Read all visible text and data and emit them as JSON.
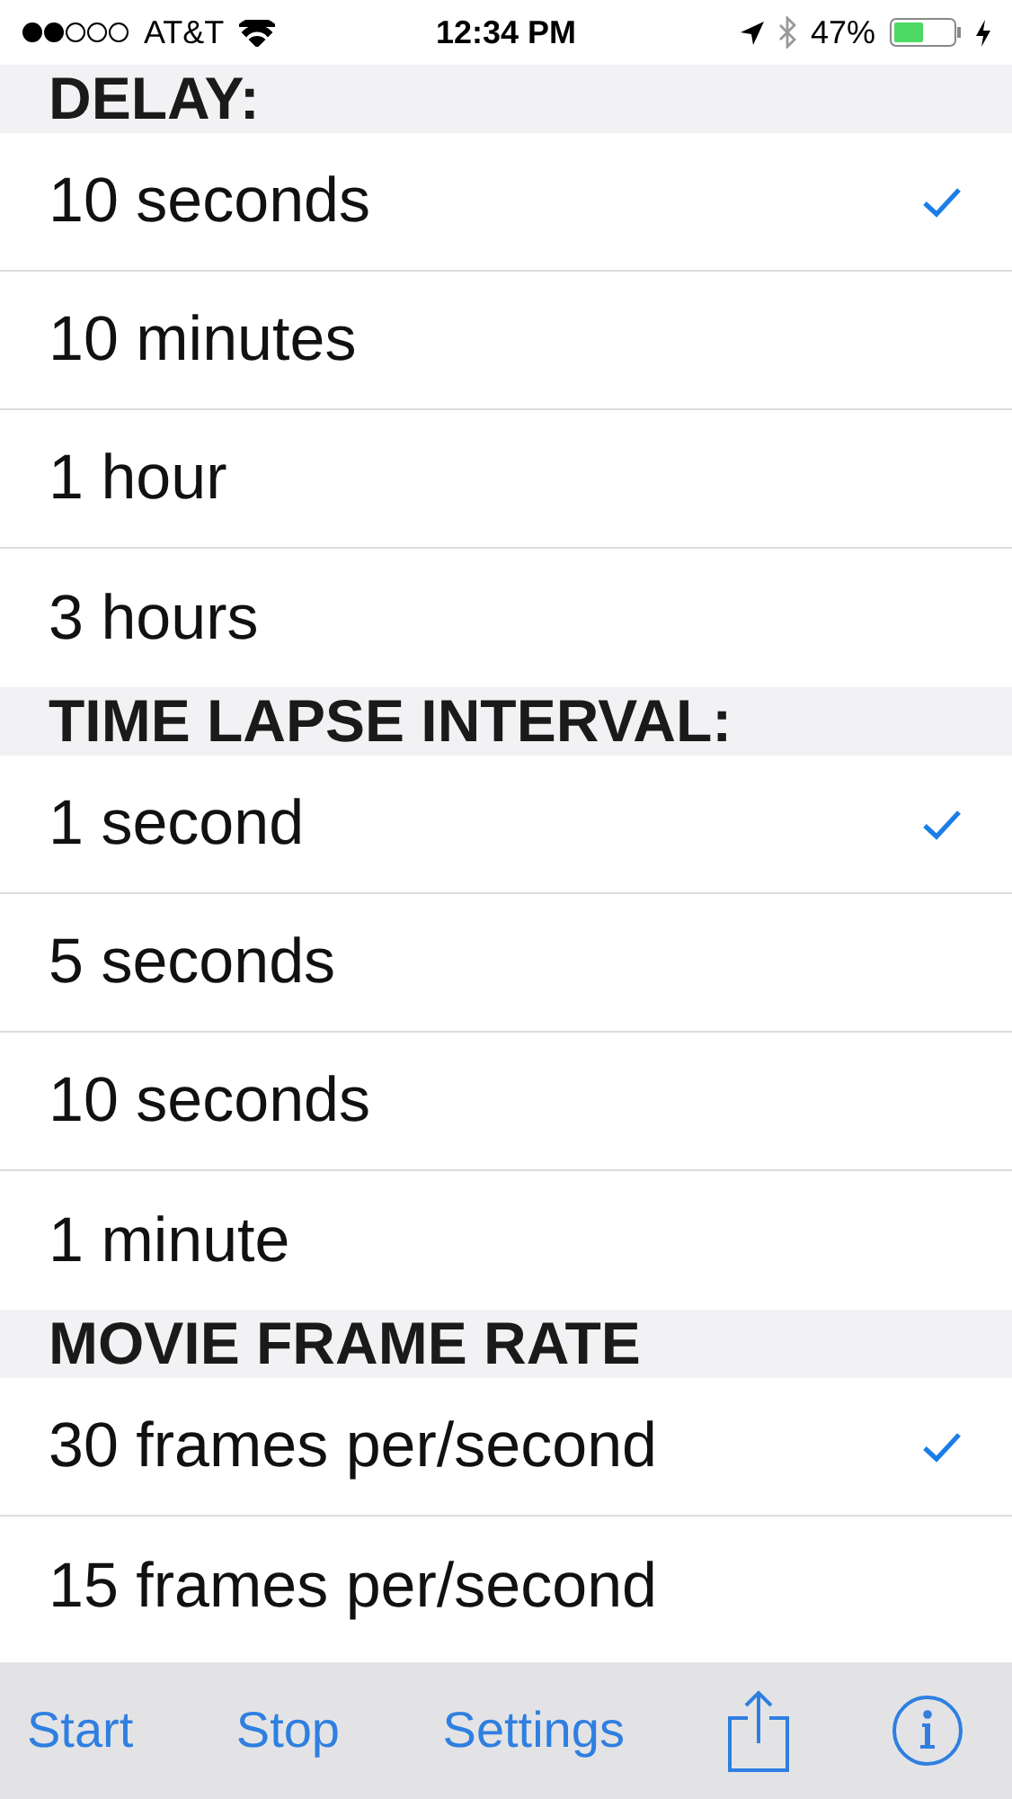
{
  "status_bar": {
    "carrier": "AT&T",
    "time": "12:34 PM",
    "battery": "47%"
  },
  "sections": [
    {
      "title": "DELAY:",
      "options": [
        {
          "label": "10 seconds",
          "selected": true
        },
        {
          "label": "10 minutes",
          "selected": false
        },
        {
          "label": "1 hour",
          "selected": false
        },
        {
          "label": "3 hours",
          "selected": false
        }
      ]
    },
    {
      "title": "TIME LAPSE INTERVAL:",
      "options": [
        {
          "label": "1 second",
          "selected": true
        },
        {
          "label": "5 seconds",
          "selected": false
        },
        {
          "label": "10 seconds",
          "selected": false
        },
        {
          "label": "1 minute",
          "selected": false
        }
      ]
    },
    {
      "title": "MOVIE FRAME RATE",
      "options": [
        {
          "label": "30 frames per/second",
          "selected": true
        },
        {
          "label": "15 frames per/second",
          "selected": false
        }
      ]
    }
  ],
  "toolbar": [
    "Start",
    "Stop",
    "Settings"
  ]
}
